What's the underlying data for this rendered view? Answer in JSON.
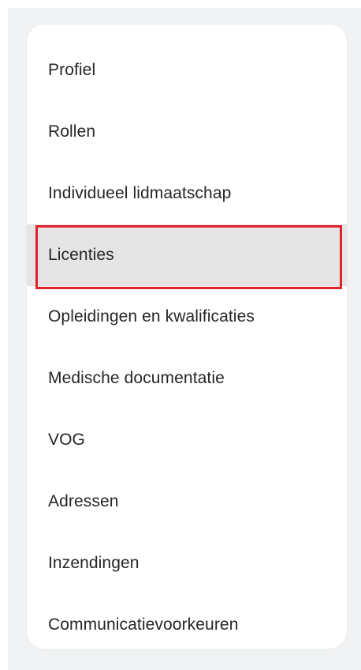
{
  "menu": {
    "items": [
      {
        "label": "Profiel",
        "active": false
      },
      {
        "label": "Rollen",
        "active": false
      },
      {
        "label": "Individueel lidmaatschap",
        "active": false
      },
      {
        "label": "Licenties",
        "active": true
      },
      {
        "label": "Opleidingen en kwalificaties",
        "active": false
      },
      {
        "label": "Medische documentatie",
        "active": false
      },
      {
        "label": "VOG",
        "active": false
      },
      {
        "label": "Adressen",
        "active": false
      },
      {
        "label": "Inzendingen",
        "active": false
      },
      {
        "label": "Communicatievoorkeuren",
        "active": false
      }
    ]
  },
  "colors": {
    "background": "#f1f2f4",
    "card": "#ffffff",
    "text": "#262626",
    "active_background": "#e5e5e5",
    "highlight_border": "#e0232a"
  }
}
